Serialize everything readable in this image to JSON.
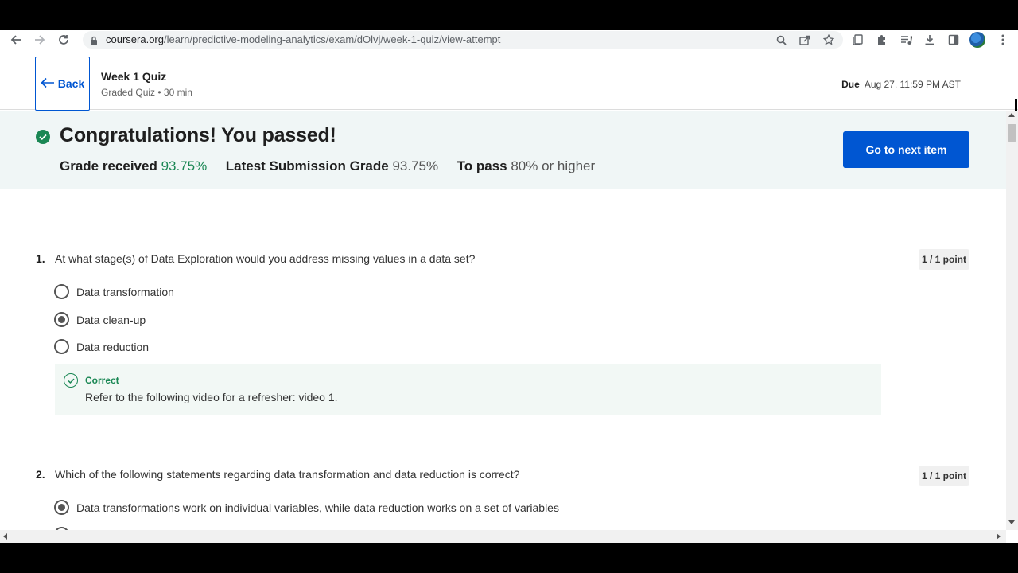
{
  "browser": {
    "url_host": "coursera.org",
    "url_path": "/learn/predictive-modeling-analytics/exam/dOlvj/week-1-quiz/view-attempt",
    "icons": [
      "back-arrow-icon",
      "forward-arrow-icon",
      "reload-icon",
      "lock-icon",
      "search-icon",
      "share-icon",
      "star-icon",
      "reading-list-icon",
      "extensions-icon",
      "media-icon",
      "download-icon",
      "side-panel-icon",
      "profile-avatar",
      "kebab-menu-icon"
    ]
  },
  "header": {
    "back_label": "Back",
    "title": "Week 1 Quiz",
    "subtitle": "Graded Quiz • 30 min",
    "due_label": "Due",
    "due_value": "Aug 27, 11:59 PM AST"
  },
  "banner": {
    "title": "Congratulations! You passed!",
    "grade_received_label": "Grade received",
    "grade_received_value": "93.75%",
    "latest_label": "Latest Submission Grade",
    "latest_value": "93.75%",
    "to_pass_label": "To pass",
    "to_pass_value": "80% or higher",
    "next_button": "Go to next item",
    "accent": "#1a8754"
  },
  "questions": [
    {
      "number": "1.",
      "text": "At what stage(s) of Data Exploration would you address missing values in a data set?",
      "points": "1 / 1 point",
      "options": [
        {
          "label": "Data transformation",
          "selected": false
        },
        {
          "label": "Data clean-up",
          "selected": true
        },
        {
          "label": "Data reduction",
          "selected": false
        }
      ],
      "feedback": {
        "title": "Correct",
        "text": "Refer to the following video for a refresher: video 1."
      }
    },
    {
      "number": "2.",
      "text": "Which of the following statements regarding data transformation and data reduction is correct?",
      "points": "1 / 1 point",
      "options": [
        {
          "label": "Data transformations work on individual variables, while data reduction works on a set of variables",
          "selected": true
        }
      ]
    }
  ],
  "colors": {
    "primary": "#0056d2",
    "success": "#1a8754",
    "banner_bg": "#f0f6f6"
  }
}
